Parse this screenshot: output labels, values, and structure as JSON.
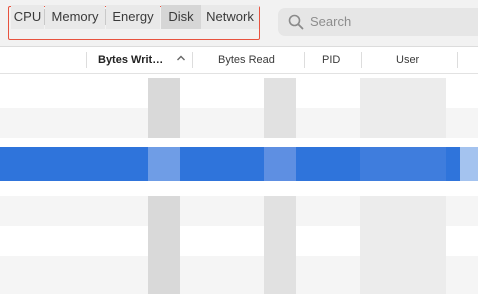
{
  "tabs": [
    {
      "label": "CPU"
    },
    {
      "label": "Memory"
    },
    {
      "label": "Energy"
    },
    {
      "label": "Disk",
      "selected": true
    },
    {
      "label": "Network"
    }
  ],
  "search": {
    "placeholder": "Search"
  },
  "columns": [
    {
      "label": "Bytes Writ…",
      "sorted": true,
      "sort_icon": "chevron-up-icon"
    },
    {
      "label": "Bytes Read"
    },
    {
      "label": "PID"
    },
    {
      "label": "User"
    }
  ],
  "icons": {
    "search": "magnifier-icon"
  },
  "colors": {
    "selection": "#2f74db",
    "highlight_border": "#e8533f"
  }
}
